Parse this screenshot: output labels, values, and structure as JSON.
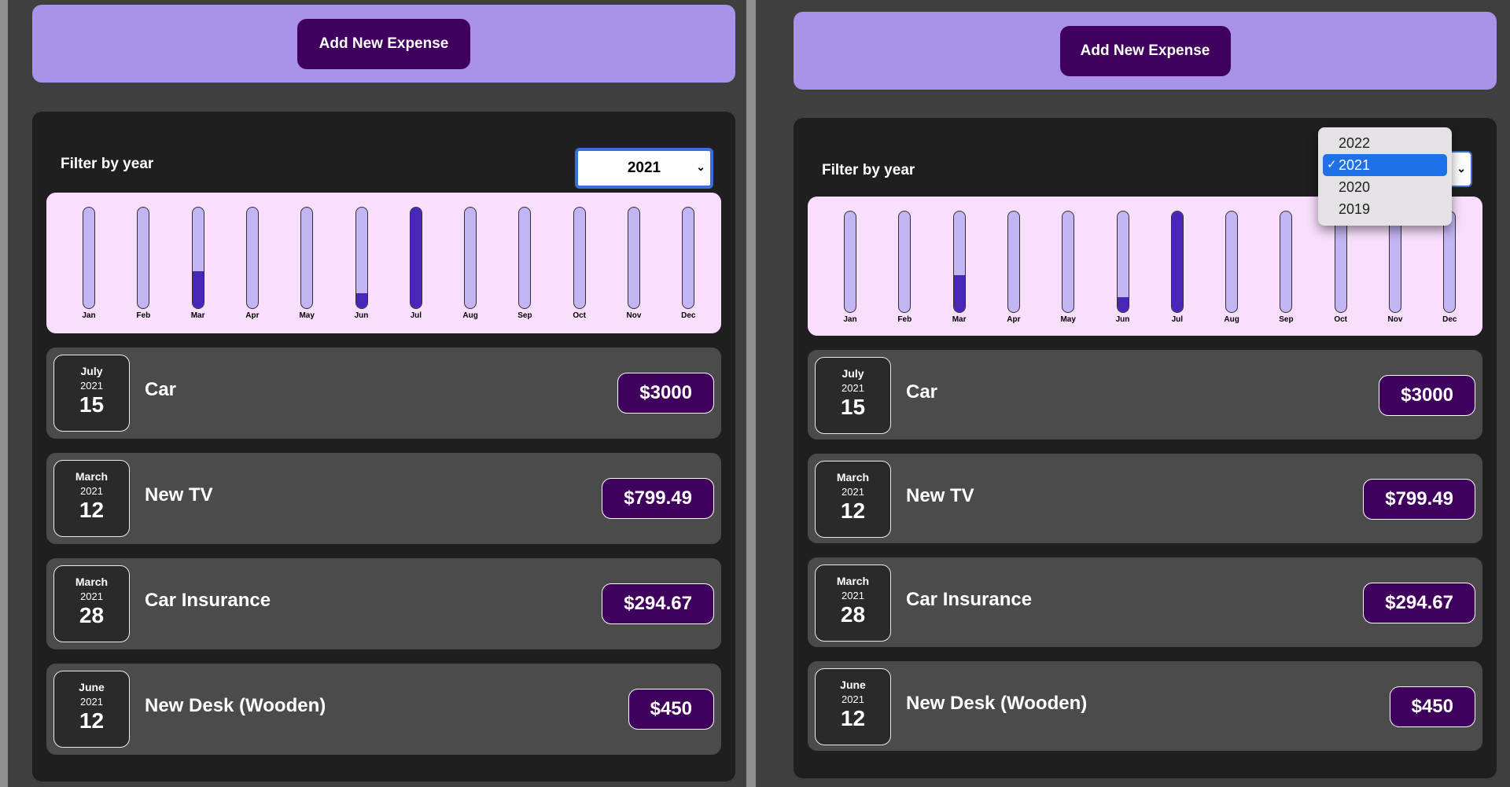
{
  "new_expense": {
    "button_label": "Add New Expense"
  },
  "filter": {
    "label": "Filter by year",
    "selected_year": "2021",
    "chevron": "⌄",
    "options": [
      "2022",
      "2021",
      "2020",
      "2019"
    ]
  },
  "chart_data": {
    "type": "bar",
    "categories": [
      "Jan",
      "Feb",
      "Mar",
      "Apr",
      "May",
      "Jun",
      "Jul",
      "Aug",
      "Sep",
      "Oct",
      "Nov",
      "Dec"
    ],
    "values": [
      0,
      0,
      1094.16,
      0,
      0,
      450,
      3000,
      0,
      0,
      0,
      0,
      0
    ],
    "ylim": [
      0,
      3000
    ]
  },
  "expenses": [
    {
      "month": "July",
      "year": "2021",
      "day": "15",
      "title": "Car",
      "amount": "$3000"
    },
    {
      "month": "March",
      "year": "2021",
      "day": "12",
      "title": "New TV",
      "amount": "$799.49"
    },
    {
      "month": "March",
      "year": "2021",
      "day": "28",
      "title": "Car Insurance",
      "amount": "$294.67"
    },
    {
      "month": "June",
      "year": "2021",
      "day": "12",
      "title": "New Desk (Wooden)",
      "amount": "$450"
    }
  ],
  "dropdown": {
    "check_mark": "✓"
  },
  "colors": {
    "accent": "#40005d",
    "card": "#a892ea",
    "chart_bg": "#f9dffd",
    "bar_fill": "#4826b9",
    "bar_track": "#c3b4f3",
    "selection": "#1f71e8"
  }
}
